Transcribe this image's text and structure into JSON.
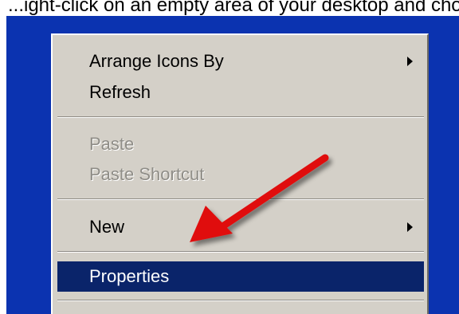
{
  "caption": "...ight-click on an empty area of your desktop and choose Properties",
  "menu": {
    "items": [
      {
        "label": "Arrange Icons By",
        "state": "enabled",
        "submenu": true
      },
      {
        "label": "Refresh",
        "state": "enabled",
        "submenu": false
      },
      {
        "label": "Paste",
        "state": "disabled",
        "submenu": false
      },
      {
        "label": "Paste Shortcut",
        "state": "disabled",
        "submenu": false
      },
      {
        "label": "New",
        "state": "enabled",
        "submenu": true
      },
      {
        "label": "Properties",
        "state": "highlighted",
        "submenu": false
      }
    ]
  },
  "colors": {
    "desktop": "#0b33b0",
    "menu_background": "#d4d0c8",
    "highlight": "#0a246a",
    "disabled_text": "#8f8d87",
    "annotation_arrow": "#e01010"
  },
  "annotation": {
    "icon": "red-arrow-pointing-to-properties"
  }
}
